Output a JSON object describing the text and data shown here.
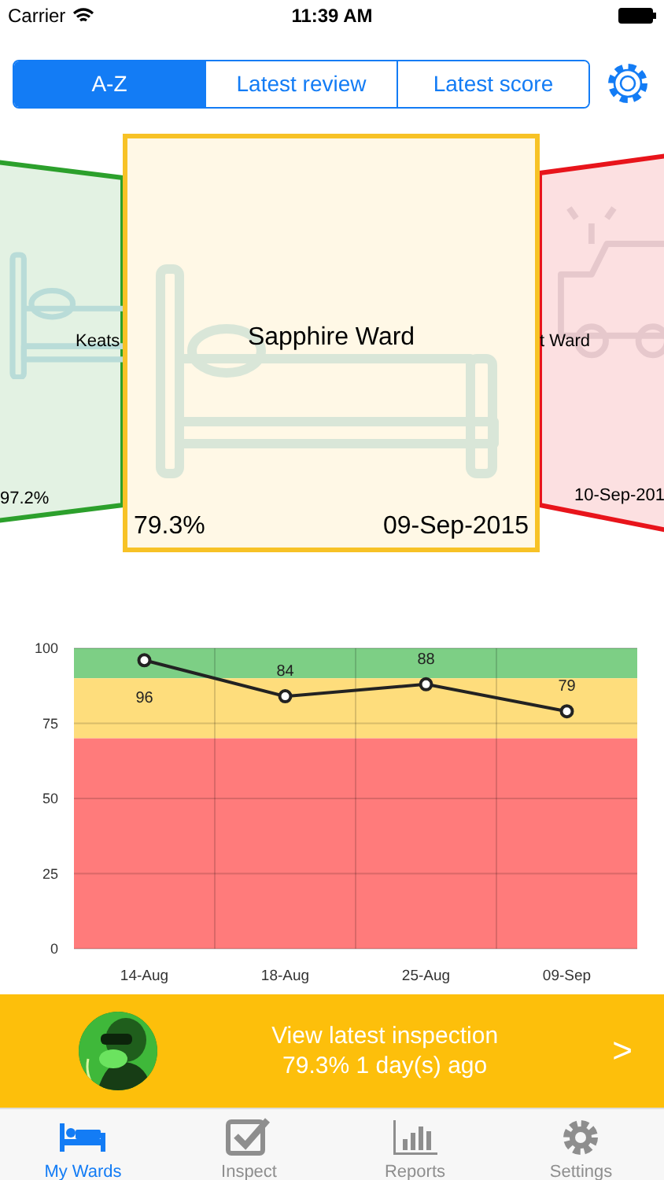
{
  "status_bar": {
    "carrier": "Carrier",
    "time": "11:39 AM"
  },
  "sort_tabs": [
    {
      "label": "A-Z",
      "selected": true
    },
    {
      "label": "Latest review",
      "selected": false
    },
    {
      "label": "Latest score",
      "selected": false
    }
  ],
  "ward_cards": [
    {
      "kind": "bed",
      "name": "Keats",
      "score": "97.2%",
      "color": "#2ca02c",
      "selected": false
    },
    {
      "kind": "bed",
      "name": "Sapphire Ward",
      "score": "79.3%",
      "date": "09-Sep-2015",
      "color": "#f7c226",
      "selected": true
    },
    {
      "kind": "ambulance",
      "name": "t Ward",
      "date": "10-Sep-201",
      "color": "#e8141b",
      "selected": false
    }
  ],
  "score_chart": {
    "chart_data": {
      "type": "line",
      "categories": [
        "14-Aug",
        "18-Aug",
        "25-Aug",
        "09-Sep"
      ],
      "series": [
        {
          "color": "#222222",
          "marker": "o",
          "values": [
            96,
            84,
            88,
            79
          ]
        }
      ],
      "ylim": [
        0,
        100
      ],
      "yticks": [
        0,
        25,
        50,
        75,
        100
      ],
      "data_labels": true,
      "grid": true,
      "bands": [
        {
          "axis": "y",
          "from": 90,
          "to": 100,
          "color": "#7dcf85"
        },
        {
          "axis": "y",
          "from": 70,
          "to": 90,
          "color": "#fedd7c"
        },
        {
          "axis": "y",
          "from": 0,
          "to": 70,
          "color": "#ff7b7b"
        }
      ]
    }
  },
  "inspection_banner": {
    "title": "View latest inspection",
    "subtitle": "79.3% 1 day(s) ago",
    "chevron": ">"
  },
  "tab_bar": [
    {
      "label": "My Wards",
      "selected": true
    },
    {
      "label": "Inspect",
      "selected": false
    },
    {
      "label": "Reports",
      "selected": false
    },
    {
      "label": "Settings",
      "selected": false
    }
  ]
}
